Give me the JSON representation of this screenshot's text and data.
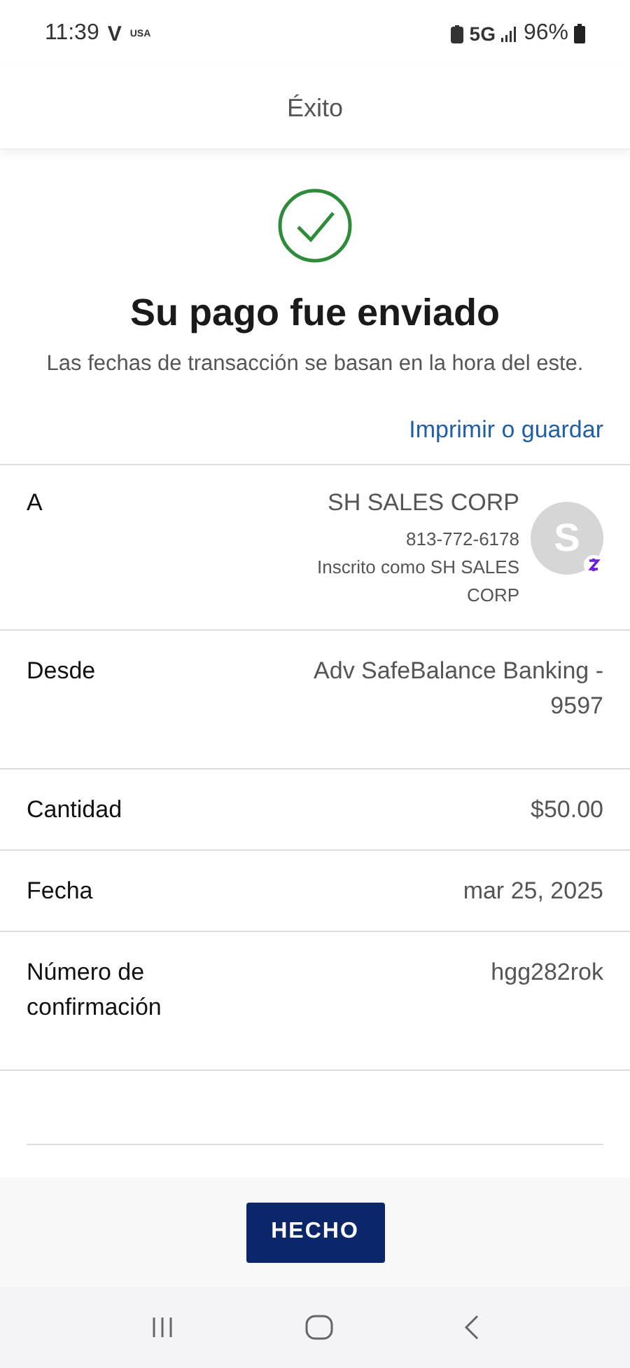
{
  "status_bar": {
    "time": "11:39",
    "carrier": "V",
    "carrier_region": "USA",
    "network": "5G",
    "battery": "96%"
  },
  "header": {
    "title": "Éxito"
  },
  "success": {
    "title": "Su pago fue enviado",
    "subtitle": "Las fechas de transacción se basan en la hora del este.",
    "link": "Imprimir o guardar"
  },
  "recipient": {
    "label": "A",
    "name": "SH SALES CORP",
    "phone": "813-772-6178",
    "enrolled": "Inscrito como SH SALES CORP",
    "avatar_letter": "S"
  },
  "details": [
    {
      "label": "Desde",
      "value": "Adv SafeBalance Banking - 9597"
    },
    {
      "label": "Cantidad",
      "value": "$50.00"
    },
    {
      "label": "Fecha",
      "value": "mar 25, 2025"
    },
    {
      "label": "Número de confirmación",
      "value": "hgg282rok"
    }
  ],
  "done_button": "HECHO"
}
